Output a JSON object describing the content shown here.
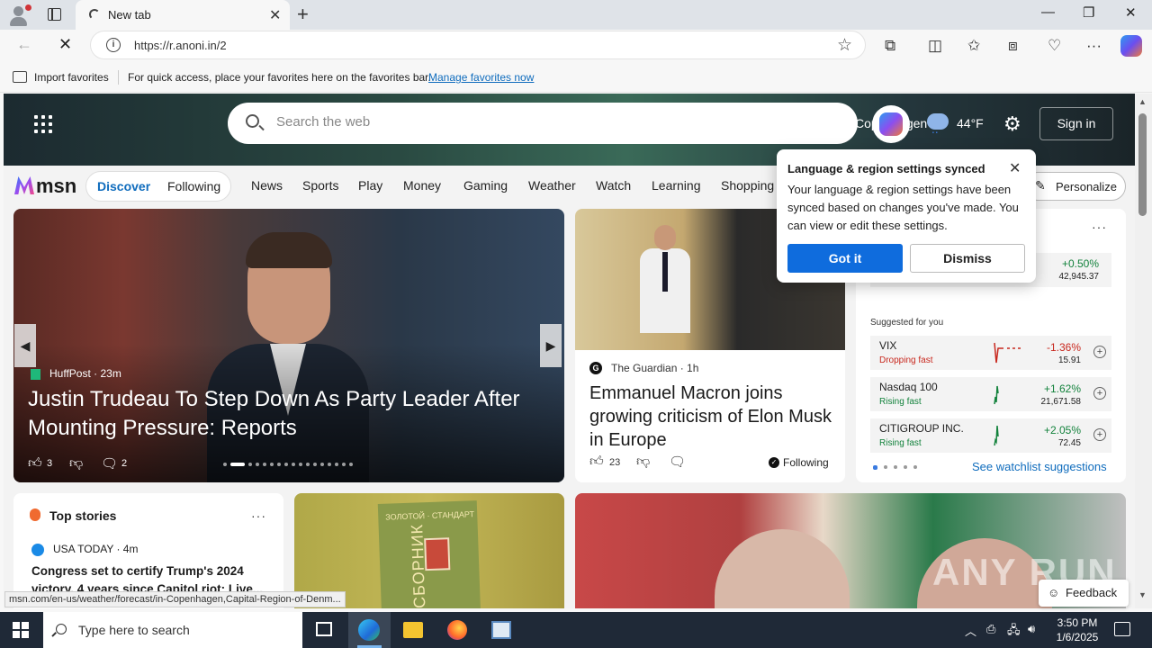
{
  "browser": {
    "tab_title": "New tab",
    "url": "https://r.anoni.in/2",
    "favbar": {
      "import_label": "Import favorites",
      "hint": "For quick access, place your favorites here on the favorites bar.",
      "manage_link": "Manage favorites now"
    }
  },
  "msn": {
    "search_placeholder": "Search the web",
    "location": "Copenhagen",
    "temperature": "44°F",
    "sign_in": "Sign in",
    "logo": "msn",
    "feed_tabs": {
      "discover": "Discover",
      "following": "Following"
    },
    "nav": [
      "News",
      "Sports",
      "Play",
      "Money",
      "Gaming",
      "Weather",
      "Watch",
      "Learning",
      "Shopping"
    ],
    "personalize": "Personalize"
  },
  "hero": {
    "source": "HuffPost · 23m",
    "headline": "Justin Trudeau To Step Down As Party Leader After Mounting Pressure: Reports",
    "likes": "3",
    "comments": "2"
  },
  "guardian": {
    "source": "The Guardian · 1h",
    "headline": "Emmanuel Macron joins growing criticism of Elon Musk in Europe",
    "likes": "23",
    "following": "Following"
  },
  "watchlist": {
    "first": {
      "pct": "+0.50%",
      "value": "42,945.37"
    },
    "suggested_label": "Suggested for you",
    "stocks": [
      {
        "name": "VIX",
        "status": "Dropping fast",
        "pct": "-1.36%",
        "value": "15.91",
        "color": "#c8281e"
      },
      {
        "name": "Nasdaq 100",
        "status": "Rising fast",
        "pct": "+1.62%",
        "value": "21,671.58",
        "color": "#13823c"
      },
      {
        "name": "CITIGROUP INC.",
        "status": "Rising fast",
        "pct": "+2.05%",
        "value": "72.45",
        "color": "#13823c"
      }
    ],
    "see_suggestions": "See watchlist suggestions"
  },
  "popup": {
    "title": "Language & region settings synced",
    "body": "Your language & region settings have been synced based on changes you've made. You can view or edit these settings.",
    "got_it": "Got it",
    "dismiss": "Dismiss"
  },
  "top_stories": {
    "title": "Top stories",
    "source": "USA TODAY · 4m",
    "headline": "Congress set to certify Trump's 2024 victory, 4 years since Capitol riot: Live..."
  },
  "book": {
    "caption": "ЗОЛОТОЙ · СТАНДАРТ",
    "vertical": "СБОРНИК"
  },
  "watermark": "ANY RUN",
  "feedback": "Feedback",
  "status_url": "msn.com/en-us/weather/forecast/in-Copenhagen,Capital-Region-of-Denm...",
  "taskbar": {
    "search_placeholder": "Type here to search",
    "time": "3:50 PM",
    "date": "1/6/2025"
  }
}
